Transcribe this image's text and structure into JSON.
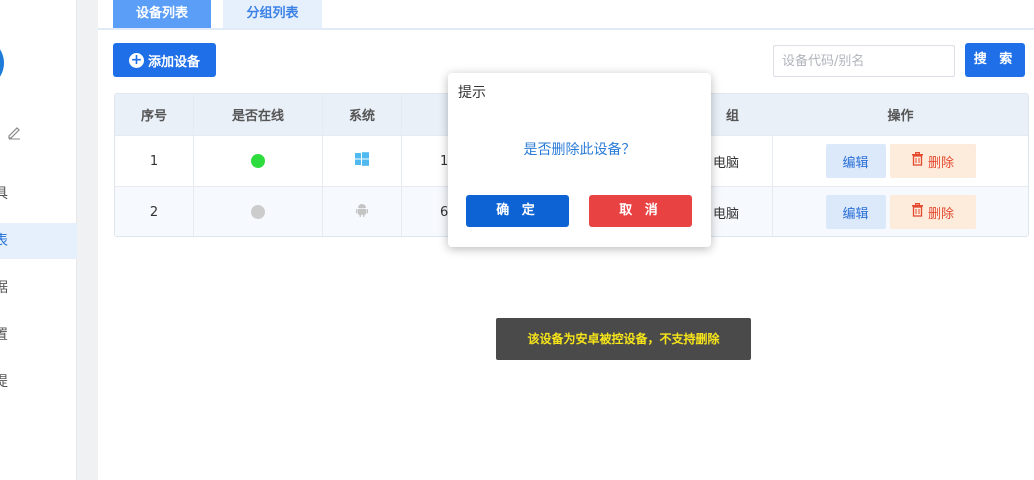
{
  "sidebar": {
    "items": [
      {
        "label": "具"
      },
      {
        "label": "表"
      },
      {
        "label": "据"
      },
      {
        "label": "置"
      },
      {
        "label": "提"
      }
    ]
  },
  "tabs": [
    {
      "label": "设备列表"
    },
    {
      "label": "分组列表"
    }
  ],
  "toolbar": {
    "add_label": "添加设备",
    "search_placeholder": "设备代码/别名",
    "search_label": "搜 索"
  },
  "table": {
    "headers": {
      "index": "序号",
      "online": "是否在线",
      "system": "系统",
      "group": "组",
      "actions": "操作"
    },
    "rows": [
      {
        "index": "1",
        "online": true,
        "system": "windows",
        "code_partial": "1",
        "group": "电脑",
        "edit": "编辑",
        "delete": "删除"
      },
      {
        "index": "2",
        "online": false,
        "system": "android",
        "code_partial": "6",
        "group": "电脑",
        "edit": "编辑",
        "delete": "删除"
      }
    ]
  },
  "dialog": {
    "title": "提示",
    "message": "是否删除此设备？",
    "confirm": "确 定",
    "cancel": "取 消"
  },
  "toast": {
    "message": "该设备为安卓被控设备，不支持删除"
  },
  "colors": {
    "primary": "#1e6fe8",
    "online": "#2fdc3e",
    "offline": "#cccccc",
    "danger": "#e84242",
    "toast_text": "#f7e51a"
  }
}
